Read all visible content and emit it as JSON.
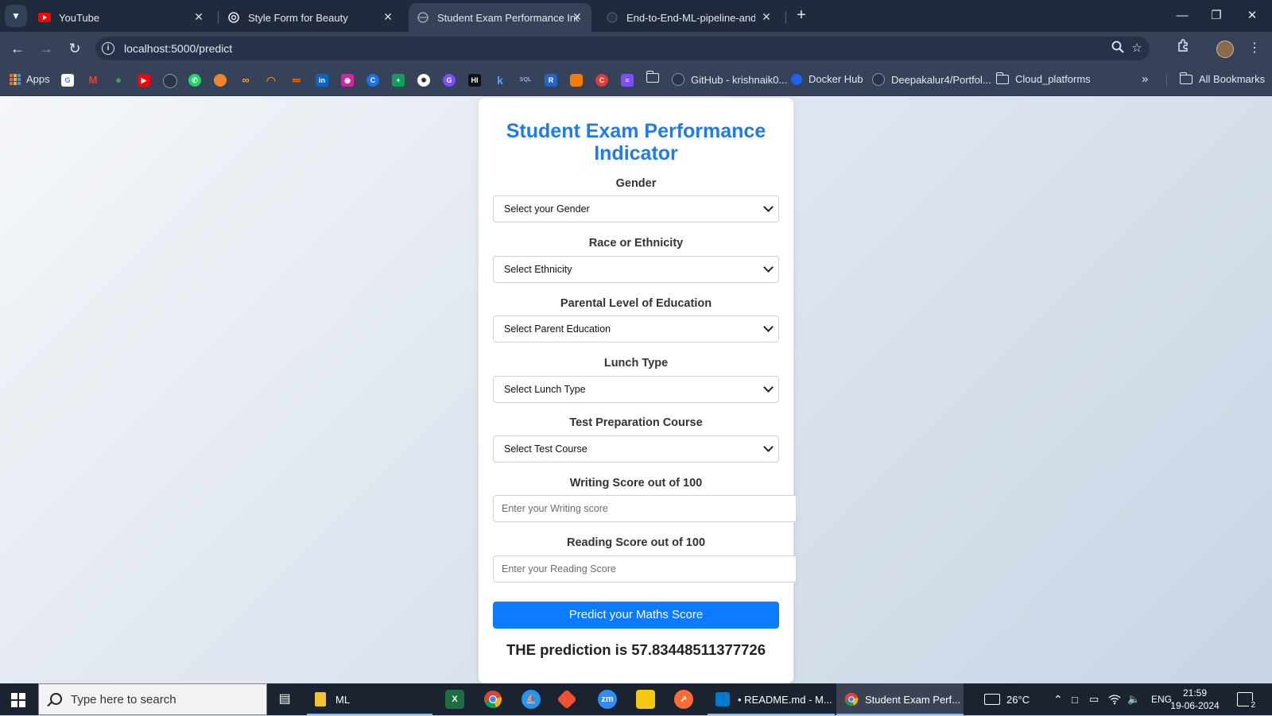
{
  "browser": {
    "tabs": [
      {
        "title": "YouTube",
        "icon": "youtube-icon",
        "active": false
      },
      {
        "title": "Style Form for Beauty",
        "icon": "openai-icon",
        "active": false
      },
      {
        "title": "Student Exam Performance Indi",
        "icon": "globe-icon",
        "active": true
      },
      {
        "title": "End-to-End-ML-pipeline-and-A",
        "icon": "github-icon",
        "active": false
      }
    ],
    "url": "localhost:5000/predict",
    "bookmarks": {
      "apps_label": "Apps",
      "items": [
        {
          "label": "GitHub - krishnaik0...",
          "icon": "github-icon"
        },
        {
          "label": "Docker Hub",
          "icon": "docker-icon"
        },
        {
          "label": "Deepakalur4/Portfol...",
          "icon": "github-icon"
        },
        {
          "label": "Cloud_platforms",
          "icon": "folder-icon"
        }
      ],
      "all_bookmarks_label": "All Bookmarks"
    }
  },
  "page": {
    "title": "Student Exam Performance Indicator",
    "fields": [
      {
        "label": "Gender",
        "type": "select",
        "value": "Select your Gender"
      },
      {
        "label": "Race or Ethnicity",
        "type": "select",
        "value": "Select Ethnicity"
      },
      {
        "label": "Parental Level of Education",
        "type": "select",
        "value": "Select Parent Education"
      },
      {
        "label": "Lunch Type",
        "type": "select",
        "value": "Select Lunch Type"
      },
      {
        "label": "Test Preparation Course",
        "type": "select",
        "value": "Select Test Course"
      },
      {
        "label": "Writing Score out of 100",
        "type": "input",
        "placeholder": "Enter your Writing score"
      },
      {
        "label": "Reading Score out of 100",
        "type": "input",
        "placeholder": "Enter your Reading Score"
      }
    ],
    "submit_label": "Predict your Maths Score",
    "prediction_text": "THE prediction is 57.83448511377726",
    "accent_color": "#1e7be8",
    "button_color": "#0b7cff"
  },
  "taskbar": {
    "search_placeholder": "Type here to search",
    "items": [
      {
        "label": "ML",
        "icon": "file-explorer-icon"
      },
      {
        "label": "• README.md - M...",
        "icon": "vscode-icon"
      },
      {
        "label": "Student Exam Perf...",
        "icon": "chrome-icon"
      }
    ],
    "weather": "26°C",
    "language": "ENG",
    "time": "21:59",
    "date": "19-06-2024",
    "notification_count": "2"
  }
}
